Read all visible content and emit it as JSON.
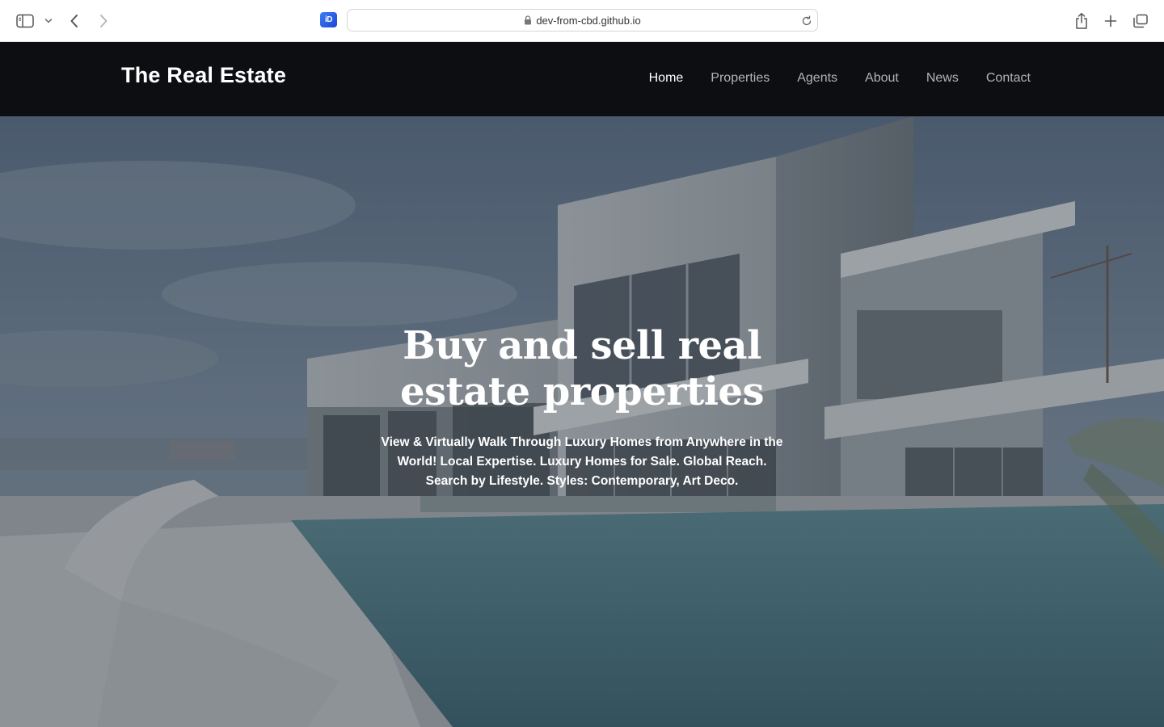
{
  "browser": {
    "url": "dev-from-cbd.github.io",
    "extension_label": "iD",
    "icons": {
      "sidebar": "sidebar-icon",
      "tab_overview_chevron": "chevron-down-icon",
      "back": "chevron-left-icon",
      "forward": "chevron-right-icon",
      "lock": "lock-icon",
      "reload": "reload-icon",
      "share": "share-icon",
      "new_tab": "plus-icon",
      "tabs": "tabs-overview-icon"
    }
  },
  "site": {
    "logo": "The Real Estate",
    "nav": [
      {
        "label": "Home",
        "active": true
      },
      {
        "label": "Properties",
        "active": false
      },
      {
        "label": "Agents",
        "active": false
      },
      {
        "label": "About",
        "active": false
      },
      {
        "label": "News",
        "active": false
      },
      {
        "label": "Contact",
        "active": false
      }
    ]
  },
  "hero": {
    "title": "Buy and sell real estate properties",
    "subtitle": "View & Virtually Walk Through Luxury Homes from Anywhere in the World! Local Expertise. Luxury Homes for Sale. Global Reach. Search by Lifestyle. Styles: Contemporary, Art Deco."
  },
  "colors": {
    "header_bg": "#0c0e12",
    "nav_active": "#ffffff",
    "nav_inactive": "#b3b3b6",
    "hero_text": "#ffffff",
    "extension_blue": "#2a5ee8"
  }
}
